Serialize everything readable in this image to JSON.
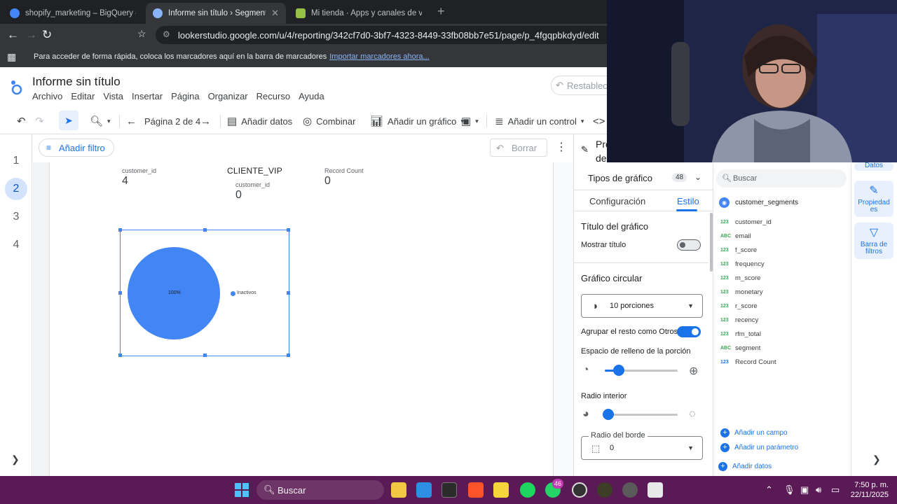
{
  "browser": {
    "tabs": [
      {
        "title": "shopify_marketing – BigQuery – Shop",
        "icon_color": "#4285f4",
        "active": false
      },
      {
        "title": "Informe sin título › Segmentación",
        "icon_color": "#8ab4f8",
        "active": true
      },
      {
        "title": "Mi tienda · Apps y canales de venta ·",
        "icon_color": "#95bf47",
        "active": false
      }
    ],
    "url": "lookerstudio.google.com/u/4/reporting/342cf7d0-3bf7-4323-8449-33fb08bb7e51/page/p_4fgqpbkdyd/edit",
    "bookmarks_message": "Para acceder de forma rápida, coloca los marcadores aquí en la barra de marcadores",
    "bookmarks_link": "Importar marcadores ahora..."
  },
  "report": {
    "title": "Informe sin título",
    "menu": [
      "Archivo",
      "Editar",
      "Vista",
      "Insertar",
      "Página",
      "Organizar",
      "Recurso",
      "Ayuda"
    ],
    "reset_label": "Restablecer"
  },
  "toolbar": {
    "page_indicator": "Página 2 de 4",
    "add_data": "Añadir datos",
    "blend": "Combinar",
    "add_chart": "Añadir un gráfico",
    "add_control": "Añadir un control"
  },
  "pages": [
    "1",
    "2",
    "3",
    "4"
  ],
  "filterbar": {
    "add_filter": "Añadir filtro",
    "clear": "Borrar"
  },
  "canvas": {
    "scorecards": [
      {
        "label": "customer_id",
        "value": "4"
      },
      {
        "label": "Record Count",
        "value": "0"
      }
    ],
    "vip_block": {
      "title": "CLIENTE_VIP",
      "label": "customer_id",
      "value": "0"
    },
    "pie": {
      "slice_label": "100%",
      "legend": "Inactivos",
      "color": "#4285f4"
    }
  },
  "chart_data": {
    "type": "pie",
    "slices": [
      {
        "label": "Inactivos",
        "value": 100
      }
    ],
    "data_labels": [
      "100%"
    ]
  },
  "properties": {
    "header": "Propiedades del gráfico circular",
    "chart_types_label": "Tipos de gráfico",
    "chart_types_count": "48",
    "tab_config": "Configuración",
    "tab_style": "Estilo",
    "chart_title_section": "Título del gráfico",
    "show_title": "Mostrar título",
    "show_title_on": false,
    "pie_section": "Gráfico circular",
    "slices_select": "10 porciones",
    "group_others": "Agrupar el resto como Otros",
    "group_others_on": true,
    "slice_padding": "Espacio de relleno de la porción",
    "slice_padding_level": 0.1,
    "inner_radius": "Radio interior",
    "inner_radius_level": 0,
    "border_radius_label": "Radio del borde",
    "border_radius_value": "0"
  },
  "data_panel": {
    "search_placeholder": "Buscar",
    "data_source": "customer_segments",
    "fields": [
      {
        "type": "123",
        "name": "customer_id"
      },
      {
        "type": "ABC",
        "name": "email"
      },
      {
        "type": "123",
        "name": "f_score"
      },
      {
        "type": "123",
        "name": "frequency"
      },
      {
        "type": "123",
        "name": "m_score"
      },
      {
        "type": "123",
        "name": "monetary"
      },
      {
        "type": "123",
        "name": "r_score"
      },
      {
        "type": "123",
        "name": "recency"
      },
      {
        "type": "123",
        "name": "rfm_total"
      },
      {
        "type": "ABC",
        "name": "segment"
      },
      {
        "type": "123",
        "name": "Record Count"
      }
    ],
    "add_field": "Añadir un campo",
    "add_parameter": "Añadir un parámetro",
    "add_data": "Añadir datos"
  },
  "rail": {
    "data": "Datos",
    "properties": "Propiedades",
    "filter_bar": "Barra de filtros"
  },
  "taskbar": {
    "search": "Buscar",
    "whatsapp_badge": "46",
    "time": "7:50 p. m.",
    "date": "22/11/2025"
  }
}
